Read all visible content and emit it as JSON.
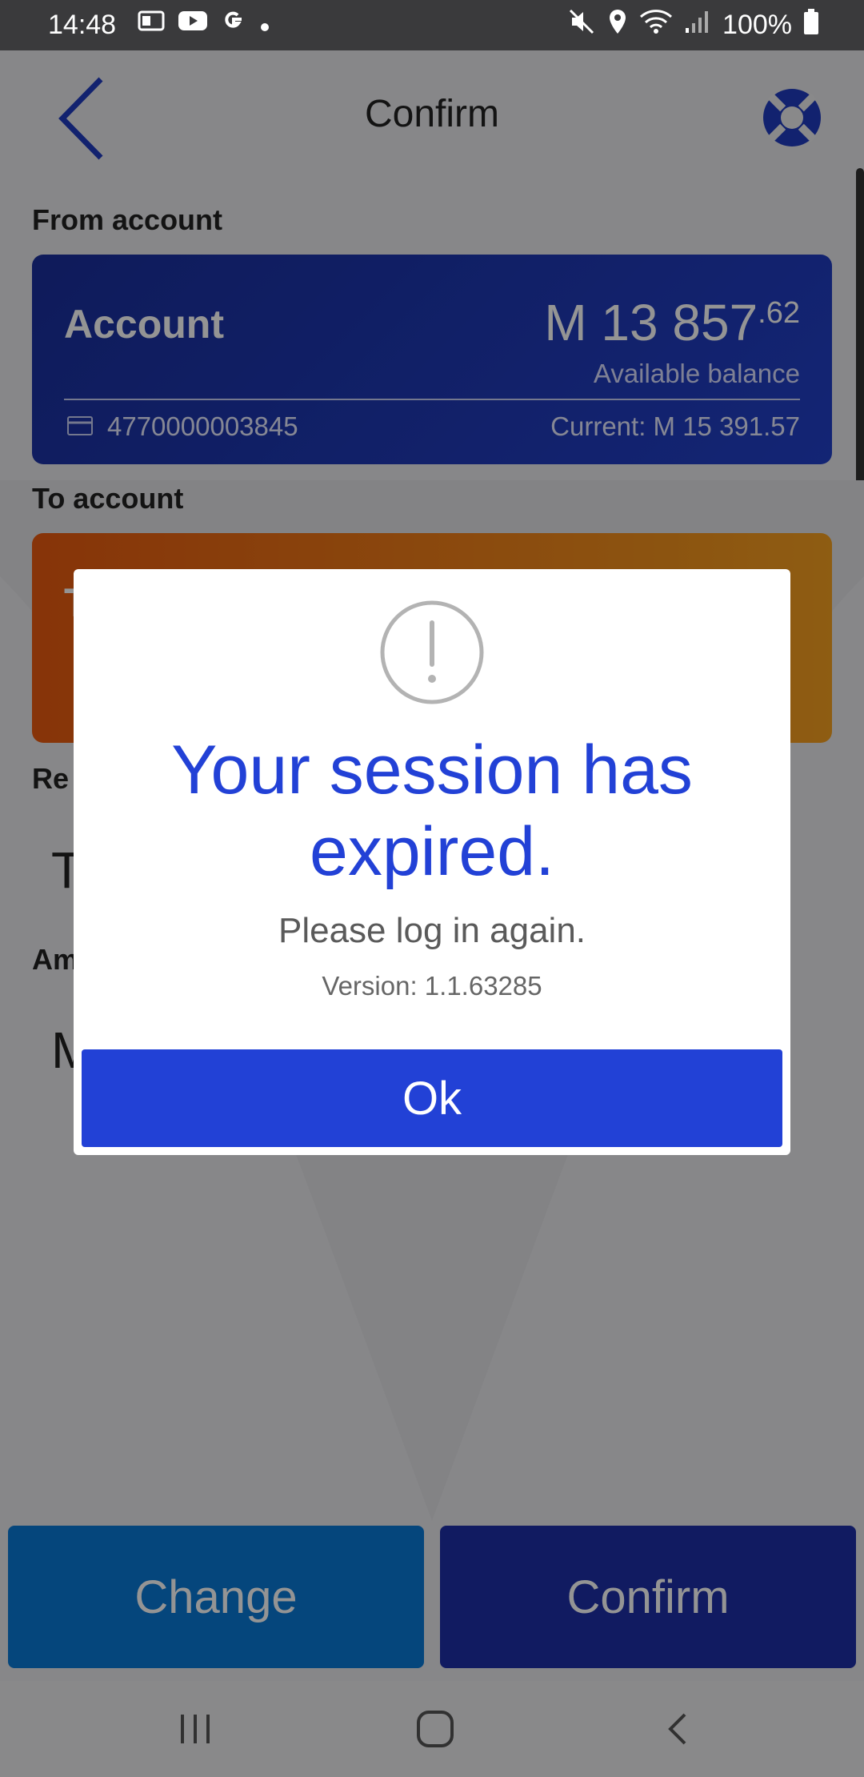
{
  "status_bar": {
    "time": "14:48",
    "battery": "100%",
    "left_icons": [
      "outlook-icon",
      "youtube-icon",
      "google-icon",
      "dot-icon"
    ],
    "right_icons": [
      "mute-icon",
      "location-icon",
      "wifi-icon",
      "signal-icon",
      "battery-icon"
    ]
  },
  "header": {
    "title": "Confirm"
  },
  "from_section": {
    "label": "From account",
    "account_name": "Account",
    "balance_main": "M 13 857",
    "balance_cents": ".62",
    "balance_caption": "Available balance",
    "account_number": "4770000003845",
    "current": "Current: M 15 391.57"
  },
  "to_section": {
    "label": "To account",
    "card_fragment": "T"
  },
  "partial_fields": {
    "reference_label_fragment": "Re",
    "reference_value_fragment": "T",
    "amount_label_fragment": "Am",
    "amount_value_fragment": "M"
  },
  "bottom_buttons": {
    "change_label": "Change",
    "confirm_label": "Confirm"
  },
  "dialog": {
    "icon": "exclamation-circle-icon",
    "title": "Your session has expired.",
    "message": "Please log in again.",
    "version": "Version: 1.1.63285",
    "ok_label": "Ok"
  },
  "colors": {
    "accent_blue": "#2241d6",
    "from_card": "#1a2f9c",
    "to_card": "#f5a020",
    "change_button": "#0a79d6",
    "confirm_button": "#1e2fa8"
  }
}
